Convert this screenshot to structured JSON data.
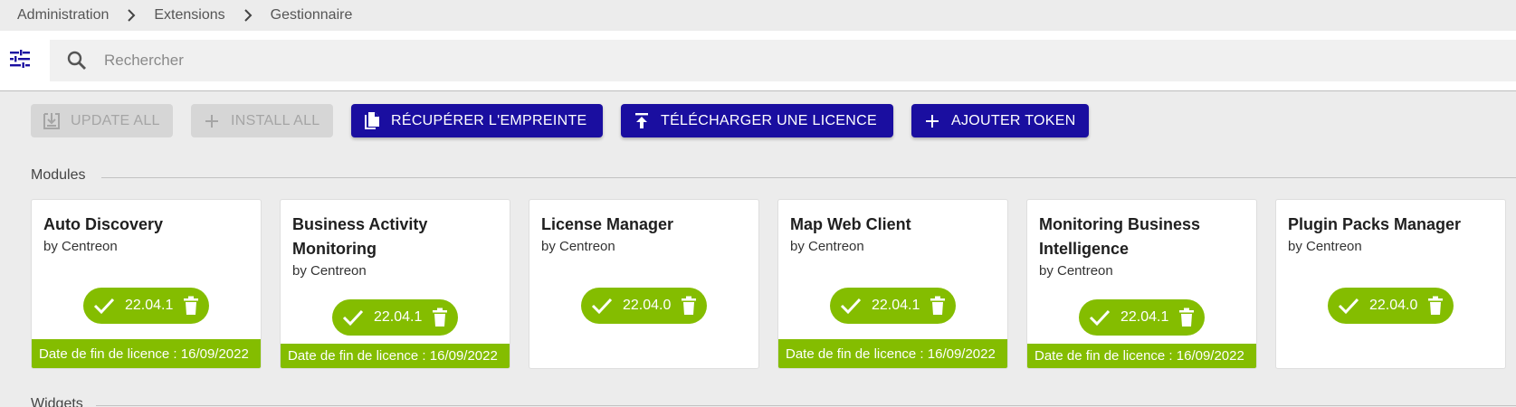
{
  "breadcrumb": [
    "Administration",
    "Extensions",
    "Gestionnaire"
  ],
  "search": {
    "placeholder": "Rechercher"
  },
  "toolbar": {
    "update_all": "UPDATE ALL",
    "install_all": "INSTALL ALL",
    "fingerprint": "RÉCUPÉRER L'EMPREINTE",
    "upload_license": "TÉLÉCHARGER UNE LICENCE",
    "add_token": "AJOUTER TOKEN"
  },
  "sections": {
    "modules": "Modules",
    "widgets": "Widgets"
  },
  "modules": [
    {
      "name": "Auto Discovery",
      "author": "by Centreon",
      "version": "22.04.1",
      "license": "Date de fin de licence : 16/09/2022"
    },
    {
      "name": "Business Activity Monitoring",
      "author": "by Centreon",
      "version": "22.04.1",
      "license": "Date de fin de licence : 16/09/2022"
    },
    {
      "name": "License Manager",
      "author": "by Centreon",
      "version": "22.04.0",
      "license": ""
    },
    {
      "name": "Map Web Client",
      "author": "by Centreon",
      "version": "22.04.1",
      "license": "Date de fin de licence : 16/09/2022"
    },
    {
      "name": "Monitoring Business Intelligence",
      "author": "by Centreon",
      "version": "22.04.1",
      "license": "Date de fin de licence : 16/09/2022"
    },
    {
      "name": "Plugin Packs Manager",
      "author": "by Centreon",
      "version": "22.04.0",
      "license": ""
    }
  ],
  "colors": {
    "primary": "#1a0ea0",
    "success": "#84bd00",
    "disabled_bg": "#d6d6d6"
  }
}
